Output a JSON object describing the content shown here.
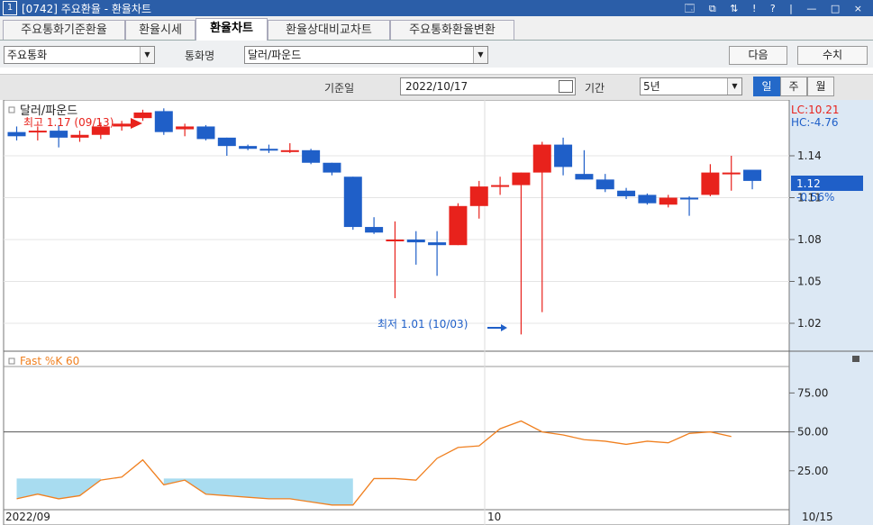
{
  "window": {
    "number": "1",
    "title": "[0742] 주요환율 - 환율차트",
    "controls": "🗔 ⧉ ⇅ ! ? | — □ ×"
  },
  "tabs": [
    {
      "label": "주요통화기준환율",
      "active": false
    },
    {
      "label": "환율시세",
      "active": false
    },
    {
      "label": "환율차트",
      "active": true
    },
    {
      "label": "환율상대비교차트",
      "active": false
    },
    {
      "label": "주요통화환율변환",
      "active": false
    }
  ],
  "toolbar": {
    "category_value": "주요통화",
    "currency_label": "통화명",
    "currency_value": "달러/파운드",
    "next_label": "다음",
    "value_label": "수치",
    "base_date_label": "기준일",
    "base_date_value": "2022/10/17",
    "period_label": "기간",
    "period_value": "5년",
    "interval_buttons": [
      {
        "label": "일",
        "active": true
      },
      {
        "label": "주",
        "active": false
      },
      {
        "label": "월",
        "active": false
      }
    ]
  },
  "colors": {
    "up": "#e8221c",
    "down": "#1f5fc8",
    "line": "#f08020",
    "fill": "#a8dcf0",
    "axis_bg": "#dce8f4"
  },
  "chart_data": [
    {
      "type": "candlestick",
      "title": "달러/파운드",
      "ylim": [
        1.0,
        1.18
      ],
      "y_ticks": [
        "1.14",
        "1.11",
        "1.08",
        "1.05",
        "1.02"
      ],
      "y_tick_values": [
        1.14,
        1.11,
        1.08,
        1.05,
        1.02
      ],
      "last_price": "1.12",
      "last_change": "-0.56%",
      "last_price_value": 1.12,
      "lc_label": "LC:10.21",
      "hc_label": "HC:-4.76",
      "high_annotation": "최고 1.17 (09/13)",
      "high_index": 6,
      "low_annotation": "최저 1.01 (10/03)",
      "low_index": 24,
      "x_labels": [
        "2022/09",
        "10"
      ],
      "x_label_index": [
        0,
        22.7
      ],
      "date_right": "10/15",
      "candles": [
        {
          "o": 1.157,
          "h": 1.161,
          "l": 1.151,
          "c": 1.154
        },
        {
          "o": 1.157,
          "h": 1.161,
          "l": 1.151,
          "c": 1.158
        },
        {
          "o": 1.158,
          "h": 1.162,
          "l": 1.146,
          "c": 1.153
        },
        {
          "o": 1.153,
          "h": 1.158,
          "l": 1.15,
          "c": 1.155
        },
        {
          "o": 1.155,
          "h": 1.164,
          "l": 1.152,
          "c": 1.161
        },
        {
          "o": 1.161,
          "h": 1.165,
          "l": 1.158,
          "c": 1.163
        },
        {
          "o": 1.167,
          "h": 1.173,
          "l": 1.165,
          "c": 1.171
        },
        {
          "o": 1.172,
          "h": 1.174,
          "l": 1.155,
          "c": 1.157
        },
        {
          "o": 1.159,
          "h": 1.163,
          "l": 1.154,
          "c": 1.161
        },
        {
          "o": 1.161,
          "h": 1.162,
          "l": 1.151,
          "c": 1.152
        },
        {
          "o": 1.153,
          "h": 1.153,
          "l": 1.14,
          "c": 1.147
        },
        {
          "o": 1.147,
          "h": 1.148,
          "l": 1.144,
          "c": 1.145
        },
        {
          "o": 1.145,
          "h": 1.148,
          "l": 1.142,
          "c": 1.144
        },
        {
          "o": 1.144,
          "h": 1.149,
          "l": 1.142,
          "c": 1.144
        },
        {
          "o": 1.144,
          "h": 1.145,
          "l": 1.134,
          "c": 1.135
        },
        {
          "o": 1.135,
          "h": 1.135,
          "l": 1.126,
          "c": 1.128
        },
        {
          "o": 1.125,
          "h": 1.125,
          "l": 1.087,
          "c": 1.089
        },
        {
          "o": 1.089,
          "h": 1.096,
          "l": 1.084,
          "c": 1.085
        },
        {
          "o": 1.08,
          "h": 1.093,
          "l": 1.038,
          "c": 1.08
        },
        {
          "o": 1.08,
          "h": 1.086,
          "l": 1.062,
          "c": 1.078
        },
        {
          "o": 1.078,
          "h": 1.086,
          "l": 1.054,
          "c": 1.076
        },
        {
          "o": 1.076,
          "h": 1.106,
          "l": 1.076,
          "c": 1.104
        },
        {
          "o": 1.104,
          "h": 1.122,
          "l": 1.095,
          "c": 1.118
        },
        {
          "o": 1.118,
          "h": 1.125,
          "l": 1.112,
          "c": 1.119
        },
        {
          "o": 1.119,
          "h": 1.128,
          "l": 1.012,
          "c": 1.128
        },
        {
          "o": 1.128,
          "h": 1.15,
          "l": 1.028,
          "c": 1.148
        },
        {
          "o": 1.148,
          "h": 1.153,
          "l": 1.126,
          "c": 1.132
        },
        {
          "o": 1.127,
          "h": 1.144,
          "l": 1.123,
          "c": 1.123
        },
        {
          "o": 1.123,
          "h": 1.127,
          "l": 1.114,
          "c": 1.116
        },
        {
          "o": 1.115,
          "h": 1.117,
          "l": 1.109,
          "c": 1.111
        },
        {
          "o": 1.112,
          "h": 1.113,
          "l": 1.105,
          "c": 1.106
        },
        {
          "o": 1.105,
          "h": 1.112,
          "l": 1.103,
          "c": 1.11
        },
        {
          "o": 1.11,
          "h": 1.111,
          "l": 1.097,
          "c": 1.109
        },
        {
          "o": 1.112,
          "h": 1.134,
          "l": 1.111,
          "c": 1.128
        },
        {
          "o": 1.127,
          "h": 1.14,
          "l": 1.115,
          "c": 1.128
        },
        {
          "o": 1.13,
          "h": 1.13,
          "l": 1.116,
          "c": 1.122
        }
      ]
    },
    {
      "type": "line",
      "title": "Fast %K 60",
      "ylim": [
        0,
        92
      ],
      "y_ticks": [
        "75.00",
        "50.00",
        "25.00"
      ],
      "y_tick_values": [
        75,
        50,
        25
      ],
      "ref_lines": [
        50
      ],
      "fill_below": 20,
      "values": [
        7,
        10,
        7,
        9,
        19,
        21,
        32,
        16,
        19,
        10,
        9,
        8,
        7,
        7,
        5,
        3,
        3,
        20,
        20,
        19,
        33,
        40,
        41,
        52,
        57,
        50,
        48,
        45,
        44,
        42,
        44,
        43,
        49,
        50,
        47
      ]
    }
  ]
}
